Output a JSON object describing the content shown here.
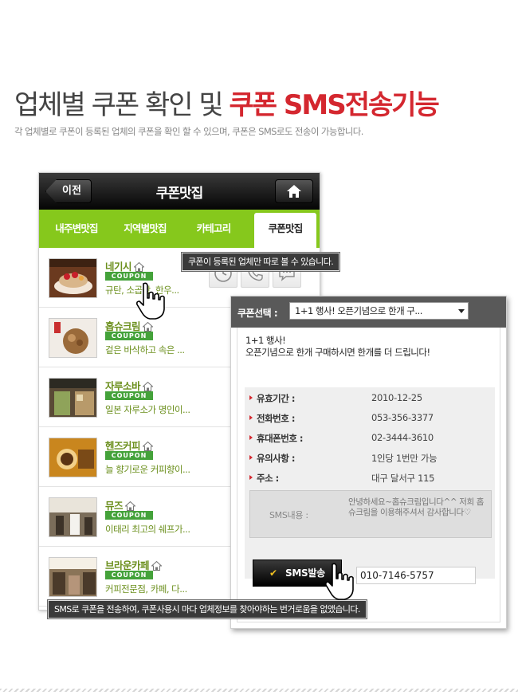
{
  "headline": {
    "part1": "업체별 쿠폰 확인 및 ",
    "part2": "쿠폰 SMS전송기능"
  },
  "subline": "각 업체별로 쿠폰이 등록된 업체의 쿠폰을 확인 할 수 있으며, 쿠폰은 SMS로도 전송이 가능합니다.",
  "app": {
    "back_label": "이전",
    "title": "쿠폰맛집",
    "tabs": [
      "내주변맛집",
      "지역별맛집",
      "카테고리",
      "쿠폰맛집"
    ],
    "active_tab": 3,
    "coupon_badge": "COUPON",
    "items": [
      {
        "name": "네기시",
        "desc": "규탄, 소곱창, 한우..."
      },
      {
        "name": "홉슈크림",
        "desc": "겉은 바삭하고 속은 ..."
      },
      {
        "name": "자루소바",
        "desc": "일본 자루소가 명인이..."
      },
      {
        "name": "헨즈커피",
        "desc": "늘 향기로운 커피향이..."
      },
      {
        "name": "뮤즈",
        "desc": "이태리 최고의 쉐프가..."
      },
      {
        "name": "브라운카페",
        "desc": "커피전문점, 카페, 다..."
      }
    ]
  },
  "tooltips": {
    "top": "쿠폰이 등록된 업체만 따로 볼 수 있습니다.",
    "bottom": "SMS로 쿠폰을 전송하여, 쿠폰사용시 마다 업체정보를 찾아야하는 번거로움을 없앴습니다."
  },
  "panel": {
    "select_label": "쿠폰선택 :",
    "select_value": "1+1 행사! 오픈기념으로 한개 구...",
    "promo_line1": "1+1 행사!",
    "promo_line2": "오픈기념으로 한개 구매하시면 한개를 더 드립니다!",
    "rows": [
      {
        "key": "유효기간 :",
        "value": "2010-12-25"
      },
      {
        "key": "전화번호 :",
        "value": "053-356-3377"
      },
      {
        "key": "휴대폰번호 :",
        "value": "02-3444-3610"
      },
      {
        "key": "유의사항 :",
        "value": "1인당 1번만 가능"
      },
      {
        "key": "주소 :",
        "value": "대구 달서구 115"
      }
    ],
    "sms_label": "SMS내용 :",
    "sms_content": "안녕하세요~홉슈크림입니다^^ 저희 홉슈크림을 이용해주셔서 감사합니다♡",
    "send_button": "SMS발송",
    "phone_value": "010-7146-5757"
  },
  "colors": {
    "accent": "#d4272f",
    "green": "#86c81c",
    "coupon_green": "#44a23a",
    "name_green": "#6b8f1c"
  }
}
